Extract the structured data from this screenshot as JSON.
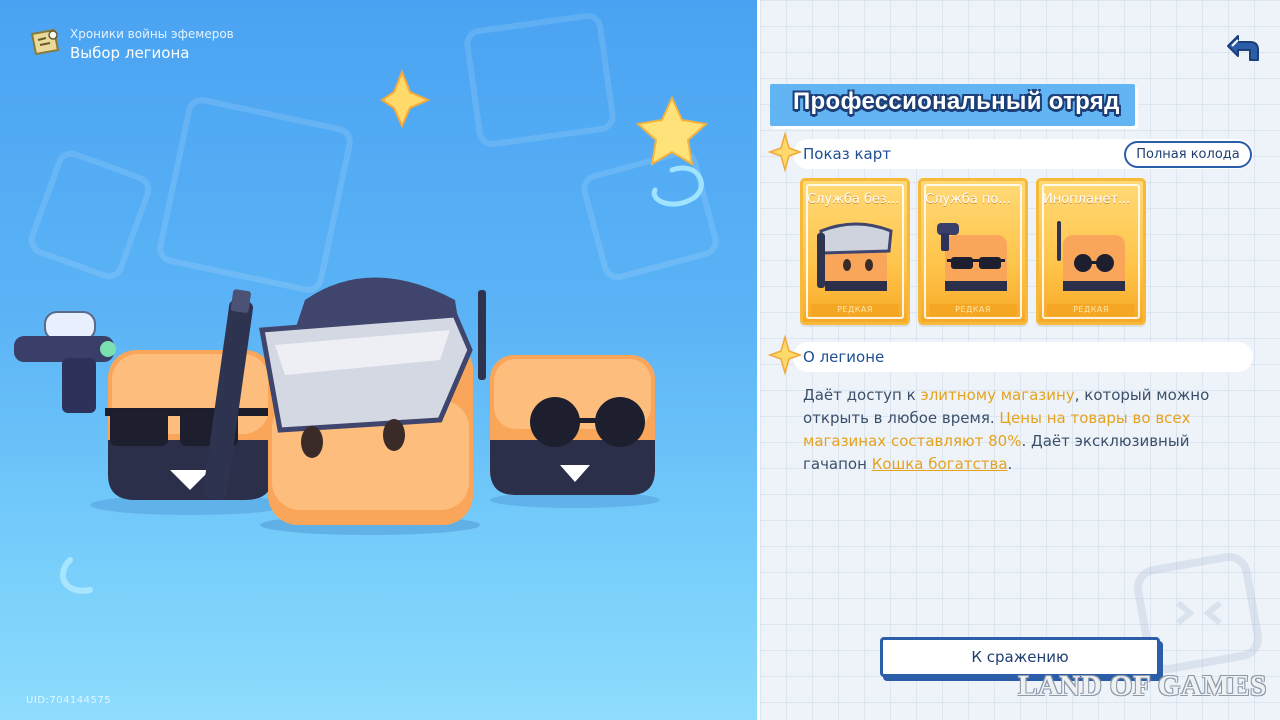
{
  "header": {
    "breadcrumb_parent": "Хроники войны эфемеров",
    "breadcrumb_current": "Выбор легиона"
  },
  "uid": "UID:704144575",
  "legion": {
    "title": "Профессиональный отряд"
  },
  "cards_section": {
    "label": "Показ карт",
    "full_deck_button": "Полная колода",
    "cards": [
      {
        "title": "Служба без...",
        "icon": "card-helmet-guard-icon",
        "rank_label": "РЕДКАЯ"
      },
      {
        "title": "Служба по...",
        "icon": "card-sunglasses-gunner-icon",
        "rank_label": "РЕДКАЯ"
      },
      {
        "title": "Инопланет...",
        "icon": "card-round-glasses-agent-icon",
        "rank_label": "РЕДКАЯ"
      }
    ]
  },
  "about_section": {
    "label": "О легионе",
    "desc_1": "Даёт доступ к ",
    "desc_hl_1": "элитному магазину",
    "desc_2": ", который можно открыть в любое время. ",
    "desc_hl_2": "Цены на товары во всех магазинах составляют 80%",
    "desc_3": ". Даёт эксклюзивный гачапон ",
    "desc_link": "Кошка богатства",
    "desc_4": "."
  },
  "actions": {
    "battle_button": "К сражению"
  },
  "watermark": "LAND OF GAMES",
  "colors": {
    "accent_blue": "#62b4f2",
    "title_outline": "#1d3f78",
    "highlight": "#e5a21e",
    "card_gold": "#ffc44a"
  }
}
